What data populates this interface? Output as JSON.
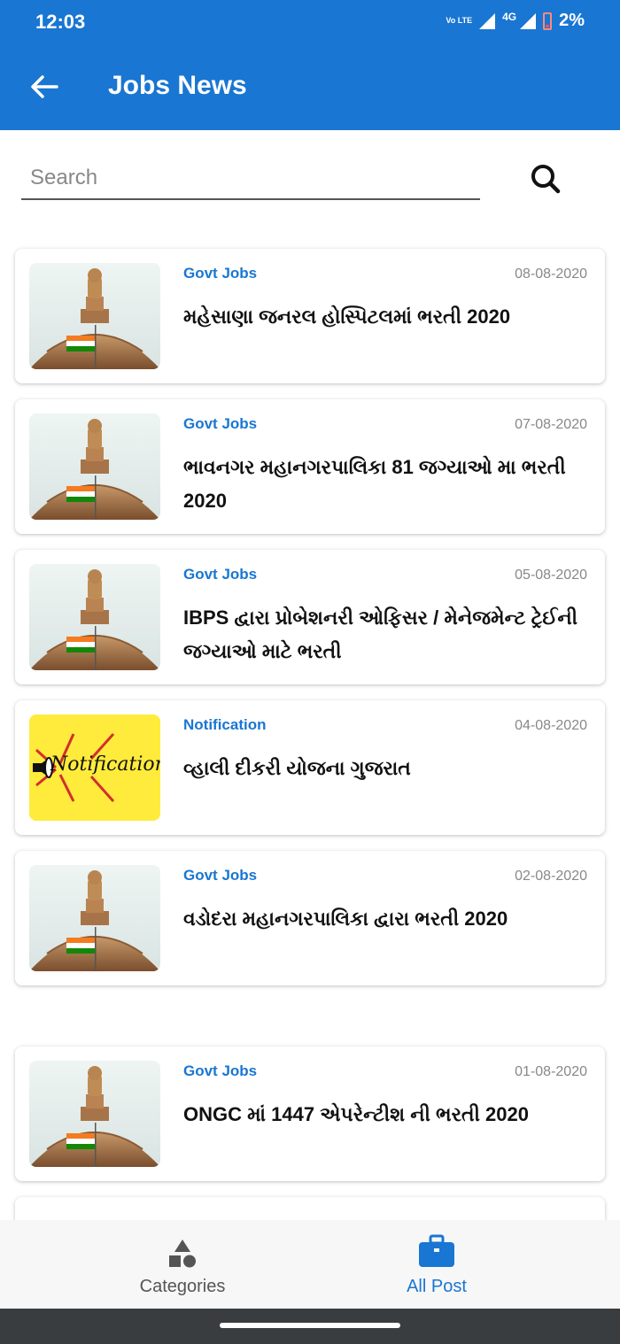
{
  "status": {
    "time": "12:03",
    "volte": "Vo LTE",
    "network": "4G",
    "battery": "2%"
  },
  "appbar": {
    "title": "Jobs News"
  },
  "search": {
    "placeholder": "Search"
  },
  "posts": [
    {
      "category": "Govt Jobs",
      "date": "08-08-2020",
      "title": "મહેસાણા જનરલ હોસ્પિટલમાં ભરતી 2020",
      "thumb": "emblem"
    },
    {
      "category": "Govt Jobs",
      "date": "07-08-2020",
      "title": "ભાવનગર મહાનગરપાલિકા 81 જગ્યાઓ મા ભરતી 2020",
      "thumb": "emblem"
    },
    {
      "category": "Govt Jobs",
      "date": "05-08-2020",
      "title": "IBPS દ્વારા પ્રોબેશનરી ઓફિસર / મેનેજમેન્ટ ટ્રેઈની જગ્યાઓ માટે ભરતી",
      "thumb": "emblem"
    },
    {
      "category": "Notification",
      "date": "04-08-2020",
      "title": "વ્હાલી દીકરી યોજના ગુજરાત",
      "thumb": "notification",
      "thumb_text": "Notification"
    },
    {
      "category": "Govt Jobs",
      "date": "02-08-2020",
      "title": "વડોદરા મહાનગરપાલિકા દ્વારા ભરતી 2020",
      "thumb": "emblem"
    },
    {
      "category": "Govt Jobs",
      "date": "01-08-2020",
      "title": "ONGC માં  1447 એપરેન્ટીશ ની ભરતી 2020",
      "thumb": "emblem"
    }
  ],
  "bottom_nav": {
    "items": [
      {
        "label": "Categories",
        "icon": "shapes-icon",
        "active": false
      },
      {
        "label": "All Post",
        "icon": "briefcase-icon",
        "active": true
      }
    ],
    "active_color": "#1976D2"
  },
  "colors": {
    "primary": "#1976D2",
    "notification_bg": "#FFEB3B"
  }
}
